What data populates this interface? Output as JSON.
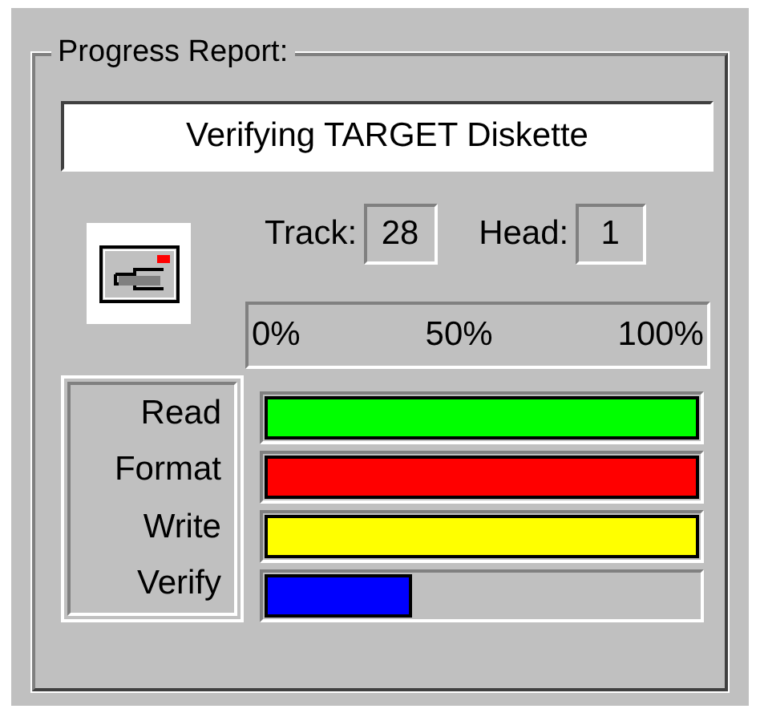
{
  "group_title": "Progress Report:",
  "status": "Verifying TARGET Diskette",
  "track": {
    "label": "Track:",
    "value": "28"
  },
  "head": {
    "label": "Head:",
    "value": "1"
  },
  "scale": [
    "0%",
    "50%",
    "100%"
  ],
  "stages": [
    {
      "name": "Read",
      "level": 1,
      "color": "#00ff00"
    },
    {
      "name": "Format",
      "level": 1,
      "color": "#ff0000"
    },
    {
      "name": "Write",
      "level": 1,
      "color": "#ffff00"
    },
    {
      "name": "Verify",
      "level": 0.34,
      "color": "#0000ff"
    }
  ]
}
